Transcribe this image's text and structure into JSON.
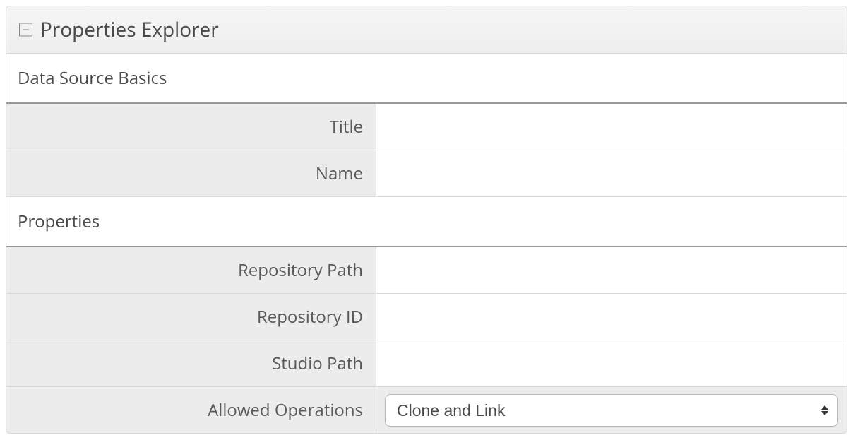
{
  "panel": {
    "title": "Properties Explorer"
  },
  "sections": {
    "basics": {
      "heading": "Data Source Basics",
      "fields": {
        "title": {
          "label": "Title",
          "value": ""
        },
        "name": {
          "label": "Name",
          "value": ""
        }
      }
    },
    "properties": {
      "heading": "Properties",
      "fields": {
        "repository_path": {
          "label": "Repository Path",
          "value": ""
        },
        "repository_id": {
          "label": "Repository ID",
          "value": ""
        },
        "studio_path": {
          "label": "Studio Path",
          "value": ""
        },
        "allowed_operations": {
          "label": "Allowed Operations",
          "selected": "Clone and Link"
        }
      }
    }
  }
}
